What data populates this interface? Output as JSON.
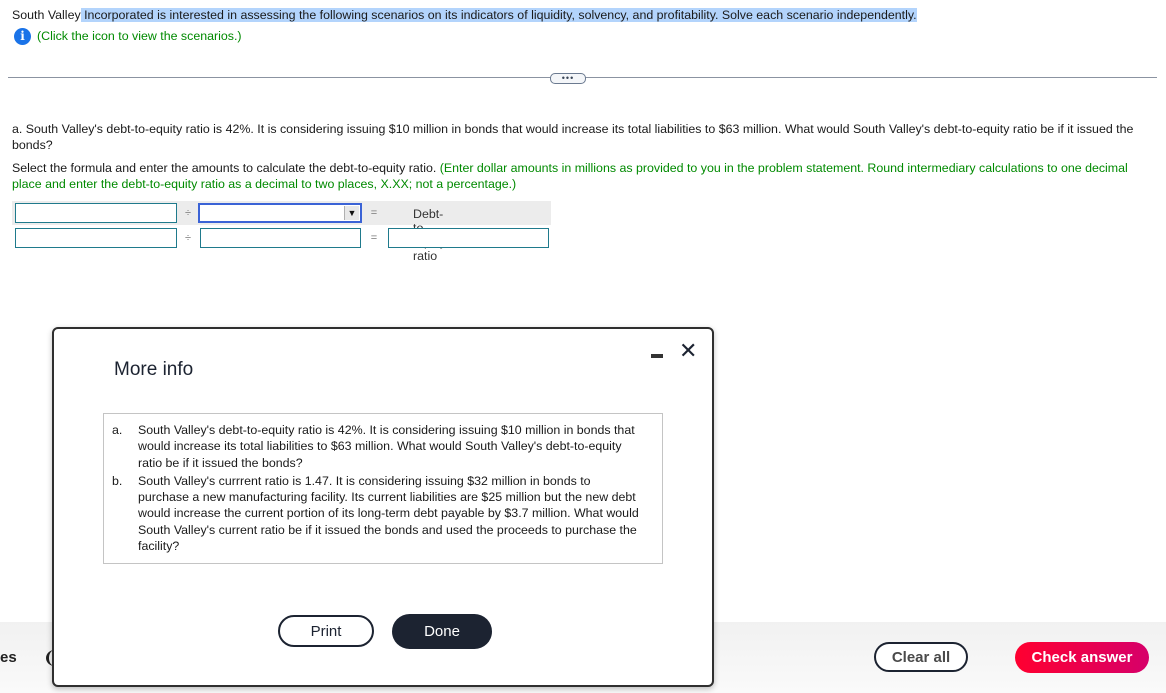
{
  "intro": {
    "prefix": "South Valley",
    "highlighted": " Incorporated is interested in assessing the following scenarios on its indicators of liquidity, solvency, and profitability. Solve each scenario independently."
  },
  "scenarios_link": {
    "icon": "info-icon",
    "label": "(Click the icon to view the scenarios.)"
  },
  "expander": {
    "label": "•••"
  },
  "question": {
    "text": "a. South Valley's debt-to-equity ratio is 42%. It is considering issuing $10 million in bonds that would increase its total liabilities to $63 million. What would South Valley's debt-to-equity ratio be if it issued the bonds?"
  },
  "instruction": {
    "text": "Select the formula and enter the amounts to calculate the debt-to-equity ratio. ",
    "hint": "(Enter dollar amounts in millions as provided to you in the problem statement. Round intermediary calculations to one decimal place and enter the debt-to-equity ratio as a decimal to two places, X.XX; not a percentage.)"
  },
  "formula": {
    "divide_symbol": "÷",
    "equals_symbol": "=",
    "result_label": "Debt-to-equity ratio",
    "row1": {
      "numerator_value": "",
      "denominator_selected": ""
    },
    "row2": {
      "numerator_value": "",
      "denominator_value": "",
      "result_value": ""
    },
    "dropdown_arrow": "▼"
  },
  "modal": {
    "title": "More info",
    "minimize_icon": "minimize-icon",
    "close_glyph": "✕",
    "scenarios": [
      {
        "label": "a.",
        "text": "South Valley's debt-to-equity ratio is 42%. It is considering issuing $10 million in bonds that would increase its total liabilities to $63 million. What would South Valley's debt-to-equity ratio be if it issued the bonds?"
      },
      {
        "label": "b.",
        "text": "South Valley's currrent ratio is 1.47. It is considering issuing $32 million in bonds to purchase a new manufacturing facility. Its current liabilities are $25 million but the new debt would increase the current portion of its long-term debt payable by $3.7 million. What would South Valley's current ratio be if it issued the bonds and used the proceeds to purchase the facility?"
      }
    ],
    "print_label": "Print",
    "done_label": "Done"
  },
  "footer": {
    "left_text": "es",
    "clear_label": "Clear all",
    "check_label": "Check answer",
    "check_color": "#ff0030"
  }
}
